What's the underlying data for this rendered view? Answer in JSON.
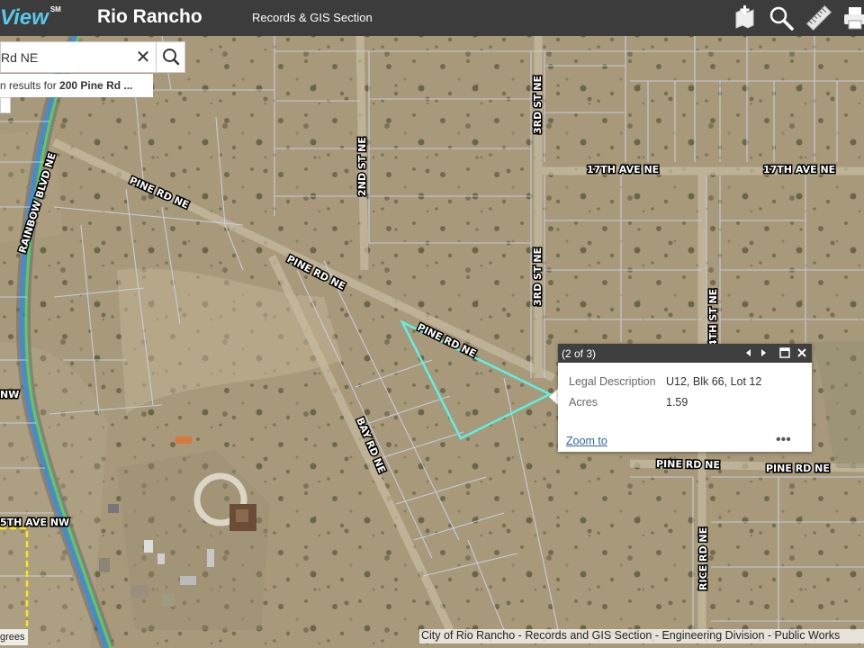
{
  "header": {
    "logo": "View",
    "logo_mark": "SM",
    "city": "Rio Rancho",
    "section": "Records & GIS Section",
    "tools": [
      "measure-icon",
      "search-icon",
      "ruler-icon",
      "print-icon"
    ]
  },
  "search": {
    "value": "Rd NE",
    "suggestion_prefix": "n results for ",
    "suggestion_term": "200 Pine Rd ..."
  },
  "roads": {
    "pine_1": "PINE RD NE",
    "pine_2": "PINE RD NE",
    "pine_3": "PINE RD NE",
    "pine_4": "PINE RD NE",
    "pine_5": "PINE RD NE",
    "rainbow": "RAINBOW BLVD NE",
    "second_st": "2ND ST NE",
    "third_st_1": "3RD ST NE",
    "third_st_2": "3RD ST NE",
    "seventeenth_1": "17TH AVE NE",
    "seventeenth_2": "17TH AVE NE",
    "fourth_st": "4TH ST NE",
    "bay": "BAY RD NE",
    "rice": "RICE RD NE",
    "left_nw": "NW",
    "fifteenth": "5TH AVE NW"
  },
  "popup": {
    "count": "(2 of 3)",
    "rows": [
      {
        "label": "Legal Description",
        "value": "U12, Blk 66, Lot 12"
      },
      {
        "label": "Acres",
        "value": "1.59"
      }
    ],
    "zoom_link": "Zoom to",
    "more": "•••"
  },
  "colors": {
    "header_bg": "#3c3c3c",
    "logo": "#5ac8ea",
    "parcel_highlight": "#5ff0e6",
    "parcel_lines": "#c8d2e6",
    "link": "#2c64b0"
  },
  "footer": {
    "attribution": "City of Rio Rancho - Records and GIS Section - Engineering Division - Public Works",
    "scale_unit": "grees"
  }
}
